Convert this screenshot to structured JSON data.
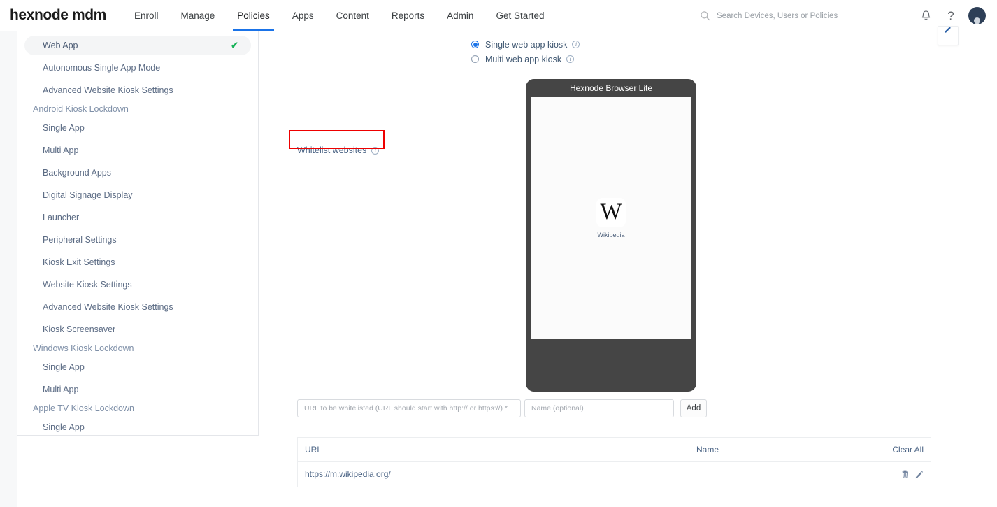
{
  "header": {
    "brand": "hexnode mdm",
    "nav": [
      {
        "label": "Enroll",
        "active": false
      },
      {
        "label": "Manage",
        "active": false
      },
      {
        "label": "Policies",
        "active": true
      },
      {
        "label": "Apps",
        "active": false
      },
      {
        "label": "Content",
        "active": false
      },
      {
        "label": "Reports",
        "active": false
      },
      {
        "label": "Admin",
        "active": false
      },
      {
        "label": "Get Started",
        "active": false
      }
    ],
    "search_placeholder": "Search Devices, Users or Policies",
    "search_value": "",
    "search_icon": "search-icon",
    "notifications_icon": "bell-icon",
    "help_icon": "question-mark-icon",
    "avatar": "user-avatar"
  },
  "sidebar": {
    "items": [
      {
        "label": "Web App",
        "type": "item",
        "active": true,
        "checked": true
      },
      {
        "label": "Autonomous Single App Mode",
        "type": "item",
        "active": false,
        "checked": false
      },
      {
        "label": "Advanced Website Kiosk Settings",
        "type": "item",
        "active": false,
        "checked": false
      },
      {
        "label": "Android Kiosk Lockdown",
        "type": "group"
      },
      {
        "label": "Single App",
        "type": "item",
        "active": false,
        "checked": false
      },
      {
        "label": "Multi App",
        "type": "item",
        "active": false,
        "checked": false
      },
      {
        "label": "Background Apps",
        "type": "item",
        "active": false,
        "checked": false
      },
      {
        "label": "Digital Signage Display",
        "type": "item",
        "active": false,
        "checked": false
      },
      {
        "label": "Launcher",
        "type": "item",
        "active": false,
        "checked": false
      },
      {
        "label": "Peripheral Settings",
        "type": "item",
        "active": false,
        "checked": false
      },
      {
        "label": "Kiosk Exit Settings",
        "type": "item",
        "active": false,
        "checked": false
      },
      {
        "label": "Website Kiosk Settings",
        "type": "item",
        "active": false,
        "checked": false
      },
      {
        "label": "Advanced Website Kiosk Settings",
        "type": "item",
        "active": false,
        "checked": false
      },
      {
        "label": "Kiosk Screensaver",
        "type": "item",
        "active": false,
        "checked": false
      },
      {
        "label": "Windows Kiosk Lockdown",
        "type": "group"
      },
      {
        "label": "Single App",
        "type": "item",
        "active": false,
        "checked": false
      },
      {
        "label": "Multi App",
        "type": "item",
        "active": false,
        "checked": false
      },
      {
        "label": "Apple TV Kiosk Lockdown",
        "type": "group"
      },
      {
        "label": "Single App",
        "type": "item",
        "active": false,
        "checked": false
      }
    ],
    "check_glyph": "✔"
  },
  "main": {
    "edit_button_icon": "edit-pencil-icon",
    "kiosk_mode": {
      "options": [
        {
          "label": "Single web app kiosk",
          "selected": true,
          "info": "info-icon"
        },
        {
          "label": "Multi web app kiosk",
          "selected": false,
          "info": "info-icon"
        }
      ]
    },
    "phone_preview": {
      "title": "Hexnode Browser Lite",
      "app": {
        "icon_glyph": "W",
        "label": "Wikipedia"
      }
    },
    "whitelist": {
      "section_label": "Whitelist websites",
      "section_info_icon": "info-icon",
      "highlight_color": "#ee0000",
      "url_placeholder": "URL to be whitelisted (URL should start with http:// or https://) *",
      "url_value": "",
      "name_placeholder": "Name (optional)",
      "name_value": "",
      "add_label": "Add",
      "table": {
        "columns": [
          "URL",
          "Name"
        ],
        "clear_all_label": "Clear All",
        "rows": [
          {
            "url": "https://m.wikipedia.org/",
            "name": "",
            "delete_icon": "trash-icon",
            "edit_icon": "pencil-icon"
          }
        ]
      }
    }
  }
}
